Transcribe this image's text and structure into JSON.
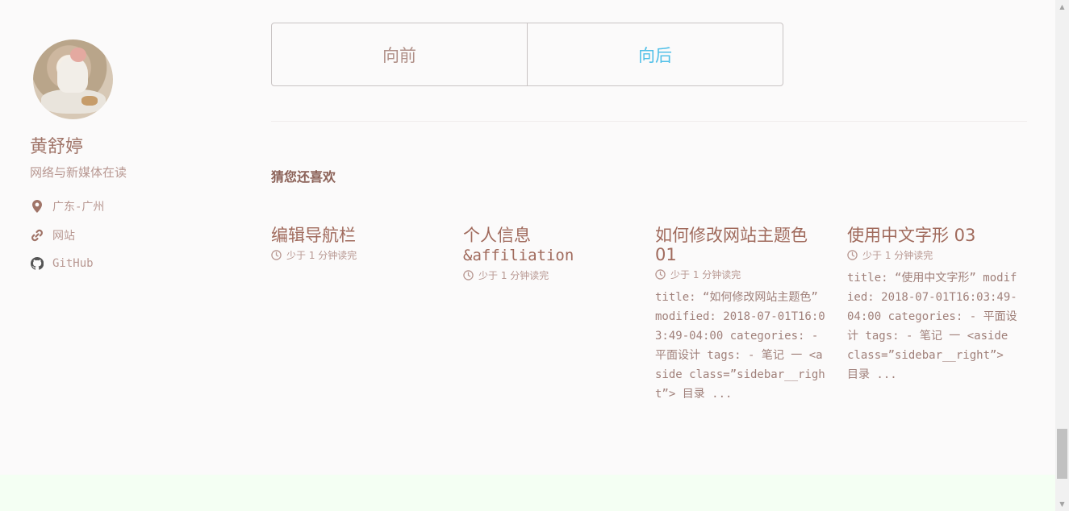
{
  "author": {
    "name": "黄舒婷",
    "bio": "网络与新媒体在读",
    "links": [
      {
        "icon": "location-pin-icon",
        "label": "广东-广州"
      },
      {
        "icon": "link-icon",
        "label": "网站"
      },
      {
        "icon": "github-icon",
        "label": "GitHub"
      }
    ]
  },
  "pager": {
    "prev_label": "向前",
    "next_label": "向后"
  },
  "related": {
    "heading": "猜您还喜欢",
    "posts": [
      {
        "title": "编辑导航栏",
        "read_time": "少于 1 分钟读完",
        "excerpt": ""
      },
      {
        "title": "个人信息 &affiliation",
        "read_time": "少于 1 分钟读完",
        "excerpt": ""
      },
      {
        "title": "如何修改网站主题色 01",
        "read_time": "少于 1 分钟读完",
        "excerpt": "title: “如何修改网站主题色” modified: 2018-07-01T16:03:49-04:00 categories: - 平面设计 tags: - 笔记 一 <aside class=”sidebar__right”> 目录 ..."
      },
      {
        "title": "使用中文字形 03",
        "read_time": "少于 1 分钟读完",
        "excerpt": "title: “使用中文字形” modified: 2018-07-01T16:03:49-04:00 categories: - 平面设计 tags: - 笔记 一 <aside class=”sidebar__right”> 目录 ..."
      }
    ]
  },
  "colors": {
    "accent_link": "#52c0e8",
    "text": "#a08078",
    "footer_band": "#f4fff3"
  }
}
